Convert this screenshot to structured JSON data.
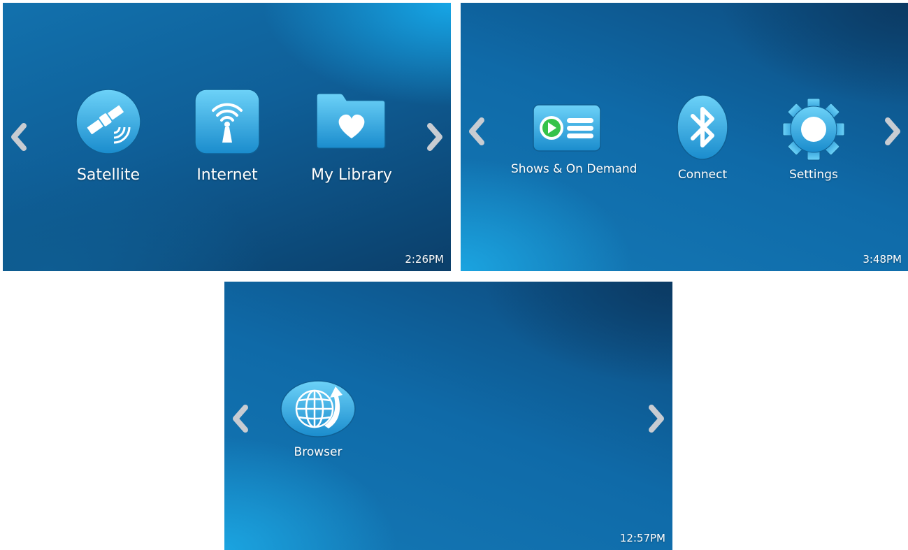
{
  "colors": {
    "icon_blue_light": "#5cc8f5",
    "icon_blue_dark": "#1b8fd0",
    "arrow_gray": "#c8ccd2",
    "play_green": "#36c24a"
  },
  "screens": [
    {
      "clock": "2:26PM",
      "items": [
        {
          "label": "Satellite",
          "icon": "satellite-icon"
        },
        {
          "label": "Internet",
          "icon": "wifi-antenna-icon"
        },
        {
          "label": "My Library",
          "icon": "heart-folder-icon"
        }
      ]
    },
    {
      "clock": "3:48PM",
      "items": [
        {
          "label": "Shows & On Demand",
          "icon": "play-list-icon"
        },
        {
          "label": "Connect",
          "icon": "bluetooth-icon"
        },
        {
          "label": "Settings",
          "icon": "gear-icon"
        }
      ]
    },
    {
      "clock": "12:57PM",
      "items": [
        {
          "label": "Browser",
          "icon": "globe-icon"
        }
      ]
    }
  ]
}
